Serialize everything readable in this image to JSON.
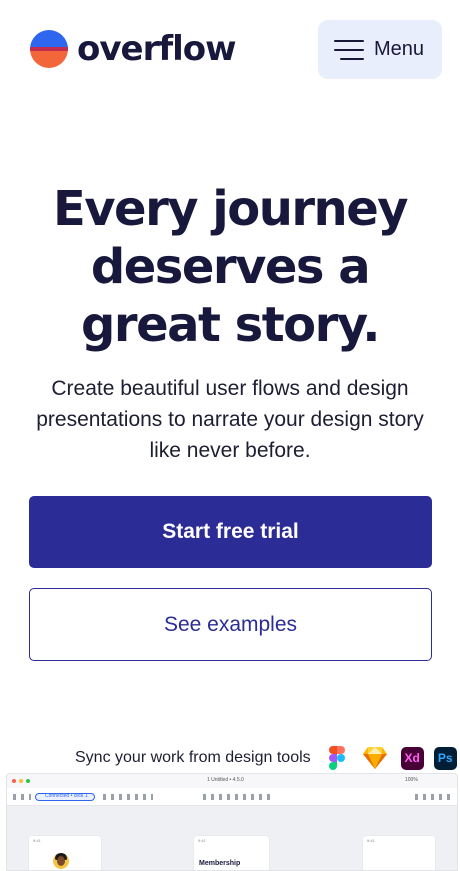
{
  "brand": {
    "name": "overflow"
  },
  "header": {
    "menu_label": "Menu"
  },
  "hero": {
    "title": "Every journey deserves a great story.",
    "subtitle": "Create beautiful user flows and design presentations to narrate your design story like never before."
  },
  "actions": {
    "primary_label": "Start free trial",
    "secondary_label": "See examples"
  },
  "integrations": {
    "label": "Sync your work from design tools",
    "tools": [
      {
        "name": "Figma",
        "icon": "figma-icon"
      },
      {
        "name": "Sketch",
        "icon": "sketch-icon"
      },
      {
        "name": "Adobe XD",
        "icon": "adobe-xd-icon",
        "abbr": "Xd"
      },
      {
        "name": "Photoshop",
        "icon": "photoshop-icon",
        "abbr": "Ps"
      }
    ]
  },
  "app_preview": {
    "doc_title": "1 Untitled • 4.5.0",
    "zoom": "100%",
    "pill_label": "Connected • click 1",
    "frames": [
      {
        "time": "9:41"
      },
      {
        "time": "9:41",
        "title": "Membership"
      },
      {
        "time": "9:41"
      }
    ]
  },
  "colors": {
    "primary": "#2c2c96",
    "text_dark": "#17183b",
    "menu_bg": "#e8eefb",
    "logo_blue": "#2f66f0",
    "logo_orange": "#f2663a"
  }
}
